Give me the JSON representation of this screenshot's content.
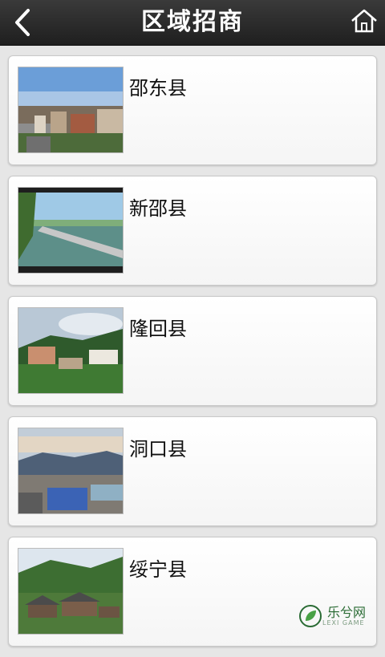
{
  "header": {
    "title": "区域招商",
    "back_icon": "chevron-left-icon",
    "home_icon": "home-icon"
  },
  "counties": [
    {
      "name": "邵东县",
      "image": "city-skyline-photo"
    },
    {
      "name": "新邵县",
      "image": "river-bridge-photo"
    },
    {
      "name": "隆回县",
      "image": "hillside-buildings-photo"
    },
    {
      "name": "洞口县",
      "image": "mountain-valley-town-photo"
    },
    {
      "name": "绥宁县",
      "image": "wooden-village-photo"
    }
  ],
  "watermark": {
    "text": "乐兮网",
    "sub": "LEXI GAME"
  },
  "colors": {
    "header_bg": "#2a2a2a",
    "page_bg": "#e6e6e6",
    "card_bg": "#ffffff"
  }
}
